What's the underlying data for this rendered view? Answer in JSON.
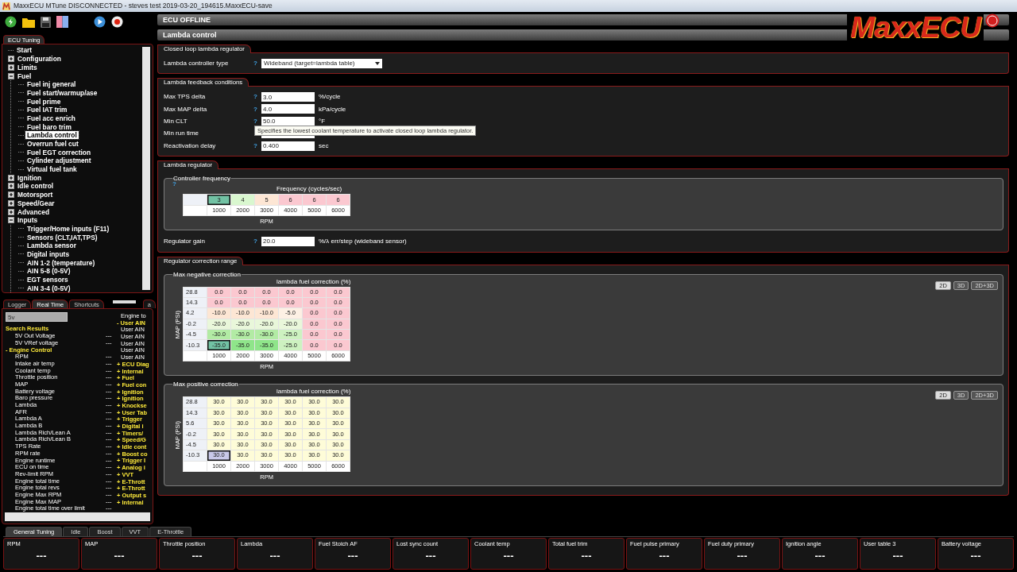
{
  "window": {
    "title": "MaxxECU MTune DISCONNECTED - steves test 2019-03-20_194615.MaxxECU-save"
  },
  "logo": {
    "text": "MaxxECU"
  },
  "tree_tabs": [
    {
      "label": "ECU Tuning",
      "selected": true
    }
  ],
  "tree": [
    {
      "label": "Start",
      "kind": "leaf",
      "selected": false
    },
    {
      "label": "Configuration",
      "kind": "group",
      "expanded": false,
      "selected": false
    },
    {
      "label": "Limits",
      "kind": "group",
      "expanded": false,
      "selected": false
    },
    {
      "label": "Fuel",
      "kind": "group",
      "expanded": true,
      "selected": false,
      "children": [
        {
          "label": "Fuel inj general",
          "selected": false
        },
        {
          "label": "Fuel start/warmup/ase",
          "selected": false
        },
        {
          "label": "Fuel prime",
          "selected": false
        },
        {
          "label": "Fuel IAT trim",
          "selected": false
        },
        {
          "label": "Fuel acc enrich",
          "selected": false
        },
        {
          "label": "Fuel baro trim",
          "selected": false
        },
        {
          "label": "Lambda control",
          "selected": true
        },
        {
          "label": "Overrun fuel cut",
          "selected": false
        },
        {
          "label": "Fuel EGT correction",
          "selected": false
        },
        {
          "label": "Cylinder adjustment",
          "selected": false
        },
        {
          "label": "Virtual fuel tank",
          "selected": false
        }
      ]
    },
    {
      "label": "Ignition",
      "kind": "group",
      "expanded": false,
      "selected": false
    },
    {
      "label": "Idle control",
      "kind": "group",
      "expanded": false,
      "selected": false
    },
    {
      "label": "Motorsport",
      "kind": "group",
      "expanded": false,
      "selected": false
    },
    {
      "label": "Speed/Gear",
      "kind": "group",
      "expanded": false,
      "selected": false
    },
    {
      "label": "Advanced",
      "kind": "group",
      "expanded": false,
      "selected": false
    },
    {
      "label": "Inputs",
      "kind": "group",
      "expanded": true,
      "selected": false,
      "children": [
        {
          "label": "Trigger/Home inputs (F11)",
          "selected": false
        },
        {
          "label": "Sensors (CLT,IAT,TPS)",
          "selected": false
        },
        {
          "label": "Lambda sensor",
          "selected": false
        },
        {
          "label": "Digital inputs",
          "selected": false
        },
        {
          "label": "AIN 1-2 (temperature)",
          "selected": false
        },
        {
          "label": "AIN 5-8 (0-5V)",
          "selected": false
        },
        {
          "label": "EGT sensors",
          "selected": false
        },
        {
          "label": "AIN 3-4 (0-5V)",
          "selected": false
        }
      ]
    }
  ],
  "realtime": {
    "tabs": [
      {
        "label": "Logger",
        "selected": false
      },
      {
        "label": "Real Time",
        "selected": true
      },
      {
        "label": "Shortcuts",
        "selected": false
      },
      {
        "label": "a",
        "selected": false
      }
    ],
    "search": {
      "value": "5v"
    },
    "signals": [
      {
        "kind": "header",
        "label": "Search Results"
      },
      {
        "kind": "signal",
        "label": "5V Out Voltage",
        "value": "---"
      },
      {
        "kind": "signal",
        "label": "5V VRef voltage",
        "value": "---"
      },
      {
        "kind": "header",
        "label": "- Engine Control"
      },
      {
        "kind": "signal",
        "label": "RPM",
        "value": "---"
      },
      {
        "kind": "signal",
        "label": "Intake air temp",
        "value": "---"
      },
      {
        "kind": "signal",
        "label": "Coolant temp",
        "value": "---"
      },
      {
        "kind": "signal",
        "label": "Throttle position",
        "value": "---"
      },
      {
        "kind": "signal",
        "label": "MAP",
        "value": "---"
      },
      {
        "kind": "signal",
        "label": "Battery voltage",
        "value": "---"
      },
      {
        "kind": "signal",
        "label": "Baro pressure",
        "value": "---"
      },
      {
        "kind": "signal",
        "label": "Lambda",
        "value": "---"
      },
      {
        "kind": "signal",
        "label": "AFR",
        "value": "---"
      },
      {
        "kind": "signal",
        "label": "Lambda A",
        "value": "---"
      },
      {
        "kind": "signal",
        "label": "Lambda B",
        "value": "---"
      },
      {
        "kind": "signal",
        "label": "Lambda Rich/Lean A",
        "value": "---"
      },
      {
        "kind": "signal",
        "label": "Lambda Rich/Lean B",
        "value": "---"
      },
      {
        "kind": "signal",
        "label": "TPS Rate",
        "value": "---"
      },
      {
        "kind": "signal",
        "label": "RPM rate",
        "value": "---"
      },
      {
        "kind": "signal",
        "label": "Engine runtime",
        "value": "---"
      },
      {
        "kind": "signal",
        "label": "ECU on time",
        "value": "---"
      },
      {
        "kind": "signal",
        "label": "Rev-limit RPM",
        "value": "---"
      },
      {
        "kind": "signal",
        "label": "Engine total time",
        "value": "---"
      },
      {
        "kind": "signal",
        "label": "Engine total revs",
        "value": "---"
      },
      {
        "kind": "signal",
        "label": "Engine Max RPM",
        "value": "---"
      },
      {
        "kind": "signal",
        "label": "Engine Max MAP",
        "value": "---"
      },
      {
        "kind": "signal",
        "label": "Engine total time over limit",
        "value": "---"
      }
    ],
    "groups": [
      {
        "kind": "item",
        "label": "Engine to"
      },
      {
        "kind": "header",
        "label": "- User AIN"
      },
      {
        "kind": "item",
        "label": "User AIN"
      },
      {
        "kind": "item",
        "label": "User AIN"
      },
      {
        "kind": "item",
        "label": "User AIN"
      },
      {
        "kind": "item",
        "label": "User AIN"
      },
      {
        "kind": "item",
        "label": "User AIN"
      },
      {
        "kind": "header",
        "label": "+ ECU Diag"
      },
      {
        "kind": "header",
        "label": "+ Internal"
      },
      {
        "kind": "header",
        "label": "+ Fuel"
      },
      {
        "kind": "header",
        "label": "+ Fuel con"
      },
      {
        "kind": "header",
        "label": "+ Ignition"
      },
      {
        "kind": "header",
        "label": "+ Ignition"
      },
      {
        "kind": "header",
        "label": "+ Knockse"
      },
      {
        "kind": "header",
        "label": "+ User Tab"
      },
      {
        "kind": "header",
        "label": "+ Trigger"
      },
      {
        "kind": "header",
        "label": "+ Digital i"
      },
      {
        "kind": "header",
        "label": "+ Timers/"
      },
      {
        "kind": "header",
        "label": "+ Speed/G"
      },
      {
        "kind": "header",
        "label": "+ Idle cont"
      },
      {
        "kind": "header",
        "label": "+ Boost co"
      },
      {
        "kind": "header",
        "label": "+ Trigger I"
      },
      {
        "kind": "header",
        "label": "+ Analog i"
      },
      {
        "kind": "header",
        "label": "+ VVT"
      },
      {
        "kind": "header",
        "label": "+ E-Thrott"
      },
      {
        "kind": "header",
        "label": "+ E-Thrott"
      },
      {
        "kind": "header",
        "label": "+ Output s"
      },
      {
        "kind": "header",
        "label": "+ Internal"
      }
    ]
  },
  "status": "ECU OFFLINE",
  "page_title": "Lambda control",
  "sections": [
    {
      "title": "Closed loop lambda regulator",
      "rows": [
        {
          "kind": "select",
          "label": "Lambda controller type",
          "help": "?",
          "value": "Wideband (target=lambda table)"
        }
      ]
    },
    {
      "title": "Lambda feedback conditions",
      "rows": [
        {
          "kind": "input",
          "label": "Max TPS delta",
          "help": "?",
          "value": "3.0",
          "unit": "%/cycle"
        },
        {
          "kind": "input",
          "label": "Max MAP delta",
          "help": "?",
          "value": "4.0",
          "unit": "kPa/cycle"
        },
        {
          "kind": "input",
          "label": "Min CLT",
          "help": "?",
          "value": "50.0",
          "unit": "°F",
          "tooltip": "Specifies the lowest coolant temperature to activate closed loop lambda regulator."
        },
        {
          "kind": "input",
          "label": "Min run time"
        },
        {
          "kind": "input",
          "label": "Reactivation delay",
          "help": "?",
          "value": "0.400",
          "unit": "sec"
        }
      ]
    },
    {
      "title": "Lambda regulator",
      "rows": [
        {
          "kind": "table",
          "legend": "Controller frequency",
          "help": "?",
          "table": {
            "title": "Frequency (cycles/sec)",
            "xlabel": "RPM",
            "x_axis": [
              "1000",
              "2000",
              "3000",
              "4000",
              "5000",
              "6000"
            ],
            "rows": [
              [
                {
                  "value": "3",
                  "color": "#72c2a4",
                  "selected": true
                },
                {
                  "value": "4",
                  "color": "#d9f7cf",
                  "selected": false
                },
                {
                  "value": "5",
                  "color": "#fde6d4",
                  "selected": false
                },
                {
                  "value": "6",
                  "color": "#fbc8d0",
                  "selected": false
                },
                {
                  "value": "6",
                  "color": "#fbc8d0",
                  "selected": false
                },
                {
                  "value": "6",
                  "color": "#fbc8d0",
                  "selected": false
                }
              ]
            ]
          }
        },
        {
          "kind": "input",
          "label": "Regulator gain",
          "help": "?",
          "value": "20.0",
          "unit": "%/λ err/step (wideband sensor)"
        }
      ]
    },
    {
      "title": "Regulator correction range",
      "rows": [
        {
          "kind": "table",
          "legend": "Max negative correction",
          "view_buttons": [
            {
              "label": "2D",
              "selected": true
            },
            {
              "label": "3D",
              "selected": false
            },
            {
              "label": "2D+3D",
              "selected": false
            }
          ],
          "table": {
            "title": "lambda fuel correction (%)",
            "ylabel": "MAP (PSI)",
            "xlabel": "RPM",
            "x_axis": [
              "1000",
              "2000",
              "3000",
              "4000",
              "5000",
              "6000"
            ],
            "y_axis": [
              "28.8",
              "14.3",
              "4.2",
              "-0.2",
              "-4.5",
              "-10.3"
            ],
            "rows": [
              [
                {
                  "value": "0.0",
                  "color": "#fbc8d0",
                  "selected": false
                },
                {
                  "value": "0.0",
                  "color": "#fbc8d0",
                  "selected": false
                },
                {
                  "value": "0.0",
                  "color": "#fbc8d0",
                  "selected": false
                },
                {
                  "value": "0.0",
                  "color": "#fbc8d0",
                  "selected": false
                },
                {
                  "value": "0.0",
                  "color": "#fbc8d0",
                  "selected": false
                },
                {
                  "value": "0.0",
                  "color": "#fbc8d0",
                  "selected": false
                }
              ],
              [
                {
                  "value": "0.0",
                  "color": "#fbc8d0",
                  "selected": false
                },
                {
                  "value": "0.0",
                  "color": "#fbc8d0",
                  "selected": false
                },
                {
                  "value": "0.0",
                  "color": "#fbc8d0",
                  "selected": false
                },
                {
                  "value": "0.0",
                  "color": "#fbc8d0",
                  "selected": false
                },
                {
                  "value": "0.0",
                  "color": "#fbc8d0",
                  "selected": false
                },
                {
                  "value": "0.0",
                  "color": "#fbc8d0",
                  "selected": false
                }
              ],
              [
                {
                  "value": "-10.0",
                  "color": "#fde6d4",
                  "selected": false
                },
                {
                  "value": "-10.0",
                  "color": "#fde6d4",
                  "selected": false
                },
                {
                  "value": "-10.0",
                  "color": "#fde6d4",
                  "selected": false
                },
                {
                  "value": "-5.0",
                  "color": "#fdf0e4",
                  "selected": false
                },
                {
                  "value": "0.0",
                  "color": "#fbc8d0",
                  "selected": false
                },
                {
                  "value": "0.0",
                  "color": "#fbc8d0",
                  "selected": false
                }
              ],
              [
                {
                  "value": "-20.0",
                  "color": "#e9f7da",
                  "selected": false
                },
                {
                  "value": "-20.0",
                  "color": "#e9f7da",
                  "selected": false
                },
                {
                  "value": "-20.0",
                  "color": "#e9f7da",
                  "selected": false
                },
                {
                  "value": "-20.0",
                  "color": "#e9f7da",
                  "selected": false
                },
                {
                  "value": "0.0",
                  "color": "#fbc8d0",
                  "selected": false
                },
                {
                  "value": "0.0",
                  "color": "#fbc8d0",
                  "selected": false
                }
              ],
              [
                {
                  "value": "-30.0",
                  "color": "#b2eba4",
                  "selected": false
                },
                {
                  "value": "-30.0",
                  "color": "#b2eba4",
                  "selected": false
                },
                {
                  "value": "-30.0",
                  "color": "#b2eba4",
                  "selected": false
                },
                {
                  "value": "-25.0",
                  "color": "#cdf2c0",
                  "selected": false
                },
                {
                  "value": "0.0",
                  "color": "#fbc8d0",
                  "selected": false
                },
                {
                  "value": "0.0",
                  "color": "#fbc8d0",
                  "selected": false
                }
              ],
              [
                {
                  "value": "-35.0",
                  "color": "#72c2a4",
                  "selected": true
                },
                {
                  "value": "-35.0",
                  "color": "#8fe58a",
                  "selected": false
                },
                {
                  "value": "-35.0",
                  "color": "#8fe58a",
                  "selected": false
                },
                {
                  "value": "-25.0",
                  "color": "#cdf2c0",
                  "selected": false
                },
                {
                  "value": "0.0",
                  "color": "#fbc8d0",
                  "selected": false
                },
                {
                  "value": "0.0",
                  "color": "#fbc8d0",
                  "selected": false
                }
              ]
            ]
          }
        },
        {
          "kind": "table",
          "legend": "Max positive correction",
          "view_buttons": [
            {
              "label": "2D",
              "selected": true
            },
            {
              "label": "3D",
              "selected": false
            },
            {
              "label": "2D+3D",
              "selected": false
            }
          ],
          "table": {
            "title": "lambda fuel correction (%)",
            "ylabel": "MAP (PSI)",
            "xlabel": "RPM",
            "x_axis": [
              "1000",
              "2000",
              "3000",
              "4000",
              "5000",
              "6000"
            ],
            "y_axis": [
              "28.8",
              "14.3",
              "5.6",
              "-0.2",
              "-4.5",
              "-10.3"
            ],
            "rows": [
              [
                {
                  "value": "30.0",
                  "color": "#fefcd8",
                  "selected": false
                },
                {
                  "value": "30.0",
                  "color": "#fefcd8",
                  "selected": false
                },
                {
                  "value": "30.0",
                  "color": "#fefcd8",
                  "selected": false
                },
                {
                  "value": "30.0",
                  "color": "#fefcd8",
                  "selected": false
                },
                {
                  "value": "30.0",
                  "color": "#fefcd8",
                  "selected": false
                },
                {
                  "value": "30.0",
                  "color": "#fefcd8",
                  "selected": false
                }
              ],
              [
                {
                  "value": "30.0",
                  "color": "#fefcd8",
                  "selected": false
                },
                {
                  "value": "30.0",
                  "color": "#fefcd8",
                  "selected": false
                },
                {
                  "value": "30.0",
                  "color": "#fefcd8",
                  "selected": false
                },
                {
                  "value": "30.0",
                  "color": "#fefcd8",
                  "selected": false
                },
                {
                  "value": "30.0",
                  "color": "#fefcd8",
                  "selected": false
                },
                {
                  "value": "30.0",
                  "color": "#fefcd8",
                  "selected": false
                }
              ],
              [
                {
                  "value": "30.0",
                  "color": "#fefcd8",
                  "selected": false
                },
                {
                  "value": "30.0",
                  "color": "#fefcd8",
                  "selected": false
                },
                {
                  "value": "30.0",
                  "color": "#fefcd8",
                  "selected": false
                },
                {
                  "value": "30.0",
                  "color": "#fefcd8",
                  "selected": false
                },
                {
                  "value": "30.0",
                  "color": "#fefcd8",
                  "selected": false
                },
                {
                  "value": "30.0",
                  "color": "#fefcd8",
                  "selected": false
                }
              ],
              [
                {
                  "value": "30.0",
                  "color": "#fefcd8",
                  "selected": false
                },
                {
                  "value": "30.0",
                  "color": "#fefcd8",
                  "selected": false
                },
                {
                  "value": "30.0",
                  "color": "#fefcd8",
                  "selected": false
                },
                {
                  "value": "30.0",
                  "color": "#fefcd8",
                  "selected": false
                },
                {
                  "value": "30.0",
                  "color": "#fefcd8",
                  "selected": false
                },
                {
                  "value": "30.0",
                  "color": "#fefcd8",
                  "selected": false
                }
              ],
              [
                {
                  "value": "30.0",
                  "color": "#fefcd8",
                  "selected": false
                },
                {
                  "value": "30.0",
                  "color": "#fefcd8",
                  "selected": false
                },
                {
                  "value": "30.0",
                  "color": "#fefcd8",
                  "selected": false
                },
                {
                  "value": "30.0",
                  "color": "#fefcd8",
                  "selected": false
                },
                {
                  "value": "30.0",
                  "color": "#fefcd8",
                  "selected": false
                },
                {
                  "value": "30.0",
                  "color": "#fefcd8",
                  "selected": false
                }
              ],
              [
                {
                  "value": "30.0",
                  "color": "#c9c9ea",
                  "selected": true
                },
                {
                  "value": "30.0",
                  "color": "#fefcd8",
                  "selected": false
                },
                {
                  "value": "30.0",
                  "color": "#fefcd8",
                  "selected": false
                },
                {
                  "value": "30.0",
                  "color": "#fefcd8",
                  "selected": false
                },
                {
                  "value": "30.0",
                  "color": "#fefcd8",
                  "selected": false
                },
                {
                  "value": "30.0",
                  "color": "#fefcd8",
                  "selected": false
                }
              ]
            ]
          }
        }
      ]
    }
  ],
  "bottom_tabs": [
    {
      "label": "General Tuning",
      "selected": true
    },
    {
      "label": "Idle",
      "selected": false
    },
    {
      "label": "Boost",
      "selected": false
    },
    {
      "label": "VVT",
      "selected": false
    },
    {
      "label": "E-Throttle",
      "selected": false
    }
  ],
  "gauges": [
    {
      "label": "RPM",
      "value": "---"
    },
    {
      "label": "MAP",
      "value": "---"
    },
    {
      "label": "Throttle position",
      "value": "---"
    },
    {
      "label": "Lambda",
      "value": "---"
    },
    {
      "label": "Fuel Stoich AF",
      "value": "---"
    },
    {
      "label": "Lost sync count",
      "value": "---"
    },
    {
      "label": "Coolant temp",
      "value": "---"
    },
    {
      "label": "Total fuel trim",
      "value": "---"
    },
    {
      "label": "Fuel pulse primary",
      "value": "---"
    },
    {
      "label": "Fuel duty primary",
      "value": "---"
    },
    {
      "label": "Ignition angle",
      "value": "---"
    },
    {
      "label": "User table 3",
      "value": "---"
    },
    {
      "label": "Battery voltage",
      "value": "---"
    }
  ]
}
